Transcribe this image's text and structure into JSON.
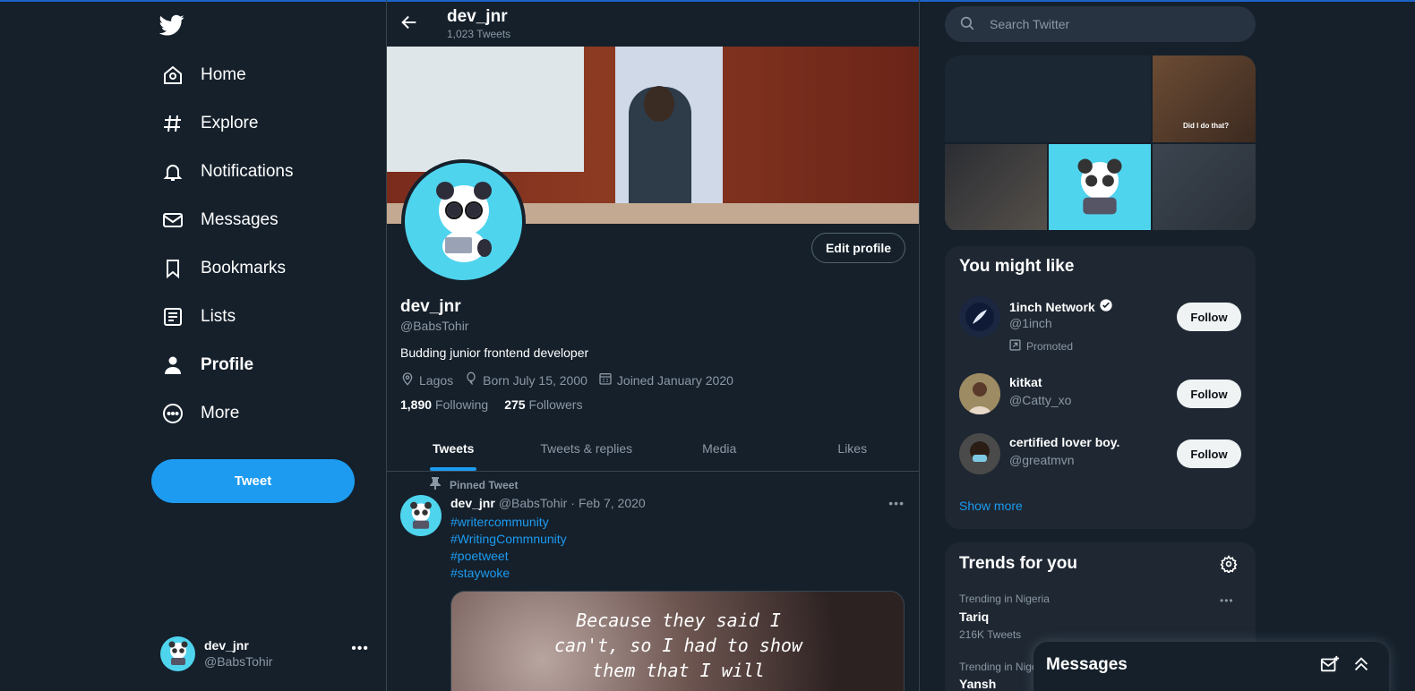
{
  "window": {
    "accent": "#1d9bf0",
    "bg": "#15202b"
  },
  "sidebar": {
    "logo_icon": "twitter-bird-icon",
    "items": [
      {
        "label": "Home",
        "icon": "home-icon"
      },
      {
        "label": "Explore",
        "icon": "hashtag-icon"
      },
      {
        "label": "Notifications",
        "icon": "bell-icon"
      },
      {
        "label": "Messages",
        "icon": "mail-icon"
      },
      {
        "label": "Bookmarks",
        "icon": "bookmark-icon"
      },
      {
        "label": "Lists",
        "icon": "list-icon"
      },
      {
        "label": "Profile",
        "icon": "person-icon",
        "active": true
      },
      {
        "label": "More",
        "icon": "more-circle-icon"
      }
    ],
    "tweet_label": "Tweet",
    "account": {
      "name": "dev_jnr",
      "handle": "@BabsTohir"
    }
  },
  "header": {
    "title": "dev_jnr",
    "subtitle": "1,023 Tweets"
  },
  "profile": {
    "edit_label": "Edit profile",
    "name": "dev_jnr",
    "handle": "@BabsTohir",
    "bio": "Budding junior frontend developer",
    "location": "Lagos",
    "birthday": "Born July 15, 2000",
    "joined": "Joined January 2020",
    "following_count": "1,890",
    "following_label": "Following",
    "followers_count": "275",
    "followers_label": "Followers"
  },
  "tabs": [
    "Tweets",
    "Tweets & replies",
    "Media",
    "Likes"
  ],
  "pinned_tweet": {
    "pinned_label": "Pinned Tweet",
    "name": "dev_jnr",
    "handle": "@BabsTohir",
    "sep": "·",
    "date": "Feb 7, 2020",
    "hashtags": [
      "#writercommunity",
      "#WritingCommnunity",
      "#poetweet",
      "#staywoke"
    ],
    "media_text": [
      "Because they said I",
      "can't, so I had to show",
      "them that I will"
    ]
  },
  "right": {
    "search_placeholder": "Search Twitter",
    "grid_caption": "Did I do that?",
    "you_might_like": {
      "title": "You might like",
      "people": [
        {
          "name": "1inch Network",
          "handle": "@1inch",
          "verified": true,
          "promoted": "Promoted",
          "button": "Follow"
        },
        {
          "name": "kitkat",
          "handle": "@Catty_xo",
          "button": "Follow"
        },
        {
          "name": "certified lover boy.",
          "handle": "@greatmvn",
          "button": "Follow"
        }
      ],
      "show_more": "Show more"
    },
    "trends": {
      "title": "Trends for you",
      "items": [
        {
          "meta": "Trending in Nigeria",
          "name": "Tariq",
          "count": "216K Tweets"
        },
        {
          "meta": "Trending in Nige",
          "name": "Yansh"
        }
      ]
    }
  },
  "messages_drawer": {
    "title": "Messages"
  }
}
